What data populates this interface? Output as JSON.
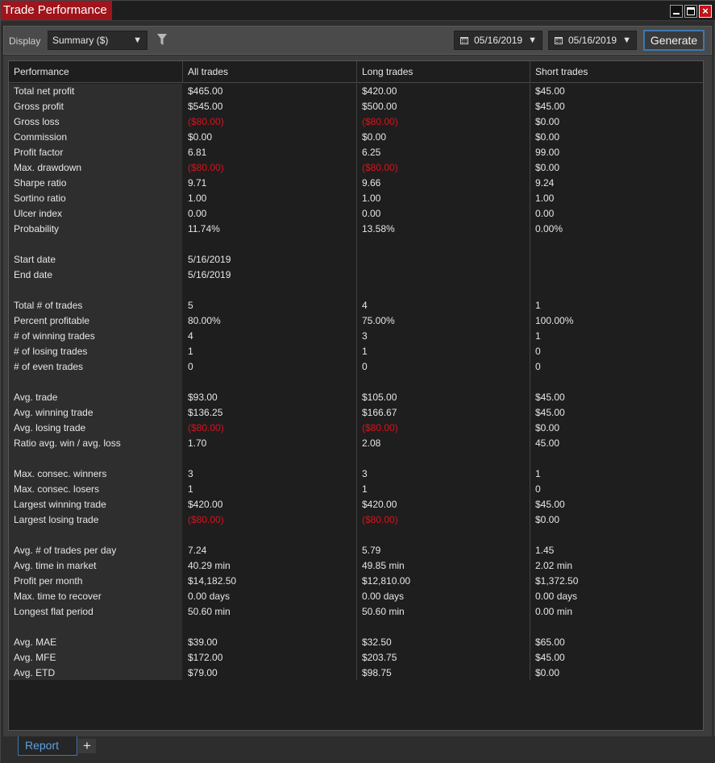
{
  "window": {
    "title": "Trade Performance"
  },
  "toolbar": {
    "display_label": "Display",
    "display_value": "Summary ($)",
    "date_from": "05/16/2019",
    "date_to": "05/16/2019",
    "generate_label": "Generate"
  },
  "table": {
    "headers": [
      "Performance",
      "All trades",
      "Long trades",
      "Short trades"
    ],
    "rows": [
      [
        "Total net profit",
        "$465.00",
        "$420.00",
        "$45.00"
      ],
      [
        "Gross profit",
        "$545.00",
        "$500.00",
        "$45.00"
      ],
      [
        "Gross loss",
        "($80.00)",
        "($80.00)",
        "$0.00"
      ],
      [
        "Commission",
        "$0.00",
        "$0.00",
        "$0.00"
      ],
      [
        "Profit factor",
        "6.81",
        "6.25",
        "99.00"
      ],
      [
        "Max. drawdown",
        "($80.00)",
        "($80.00)",
        "$0.00"
      ],
      [
        "Sharpe ratio",
        "9.71",
        "9.66",
        "9.24"
      ],
      [
        "Sortino ratio",
        "1.00",
        "1.00",
        "1.00"
      ],
      [
        "Ulcer index",
        "0.00",
        "0.00",
        "0.00"
      ],
      [
        "Probability",
        "11.74%",
        "13.58%",
        "0.00%"
      ],
      [
        "",
        "",
        "",
        ""
      ],
      [
        "Start date",
        "5/16/2019",
        "",
        ""
      ],
      [
        "End date",
        "5/16/2019",
        "",
        ""
      ],
      [
        "",
        "",
        "",
        ""
      ],
      [
        "Total # of trades",
        "5",
        "4",
        "1"
      ],
      [
        "Percent profitable",
        "80.00%",
        "75.00%",
        "100.00%"
      ],
      [
        "# of winning trades",
        "4",
        "3",
        "1"
      ],
      [
        "# of losing trades",
        "1",
        "1",
        "0"
      ],
      [
        "# of even trades",
        "0",
        "0",
        "0"
      ],
      [
        "",
        "",
        "",
        ""
      ],
      [
        "Avg. trade",
        "$93.00",
        "$105.00",
        "$45.00"
      ],
      [
        "Avg. winning trade",
        "$136.25",
        "$166.67",
        "$45.00"
      ],
      [
        "Avg. losing trade",
        "($80.00)",
        "($80.00)",
        "$0.00"
      ],
      [
        "Ratio avg. win / avg. loss",
        "1.70",
        "2.08",
        "45.00"
      ],
      [
        "",
        "",
        "",
        ""
      ],
      [
        "Max. consec. winners",
        "3",
        "3",
        "1"
      ],
      [
        "Max. consec. losers",
        "1",
        "1",
        "0"
      ],
      [
        "Largest winning trade",
        "$420.00",
        "$420.00",
        "$45.00"
      ],
      [
        "Largest losing trade",
        "($80.00)",
        "($80.00)",
        "$0.00"
      ],
      [
        "",
        "",
        "",
        ""
      ],
      [
        "Avg. # of trades per day",
        "7.24",
        "5.79",
        "1.45"
      ],
      [
        "Avg. time in market",
        "40.29 min",
        "49.85 min",
        "2.02 min"
      ],
      [
        "Profit per month",
        "$14,182.50",
        "$12,810.00",
        "$1,372.50"
      ],
      [
        "Max. time to recover",
        "0.00 days",
        "0.00 days",
        "0.00 days"
      ],
      [
        "Longest flat period",
        "50.60 min",
        "50.60 min",
        "0.00 min"
      ],
      [
        "",
        "",
        "",
        ""
      ],
      [
        "Avg. MAE",
        "$39.00",
        "$32.50",
        "$65.00"
      ],
      [
        "Avg. MFE",
        "$172.00",
        "$203.75",
        "$45.00"
      ],
      [
        "Avg. ETD",
        "$79.00",
        "$98.75",
        "$0.00"
      ]
    ]
  },
  "tabs": {
    "report_label": "Report",
    "add_label": "+"
  },
  "colors": {
    "negative": "#d8121b",
    "title_bar": "#a0141b",
    "tab_accent": "#5aa2e6"
  }
}
